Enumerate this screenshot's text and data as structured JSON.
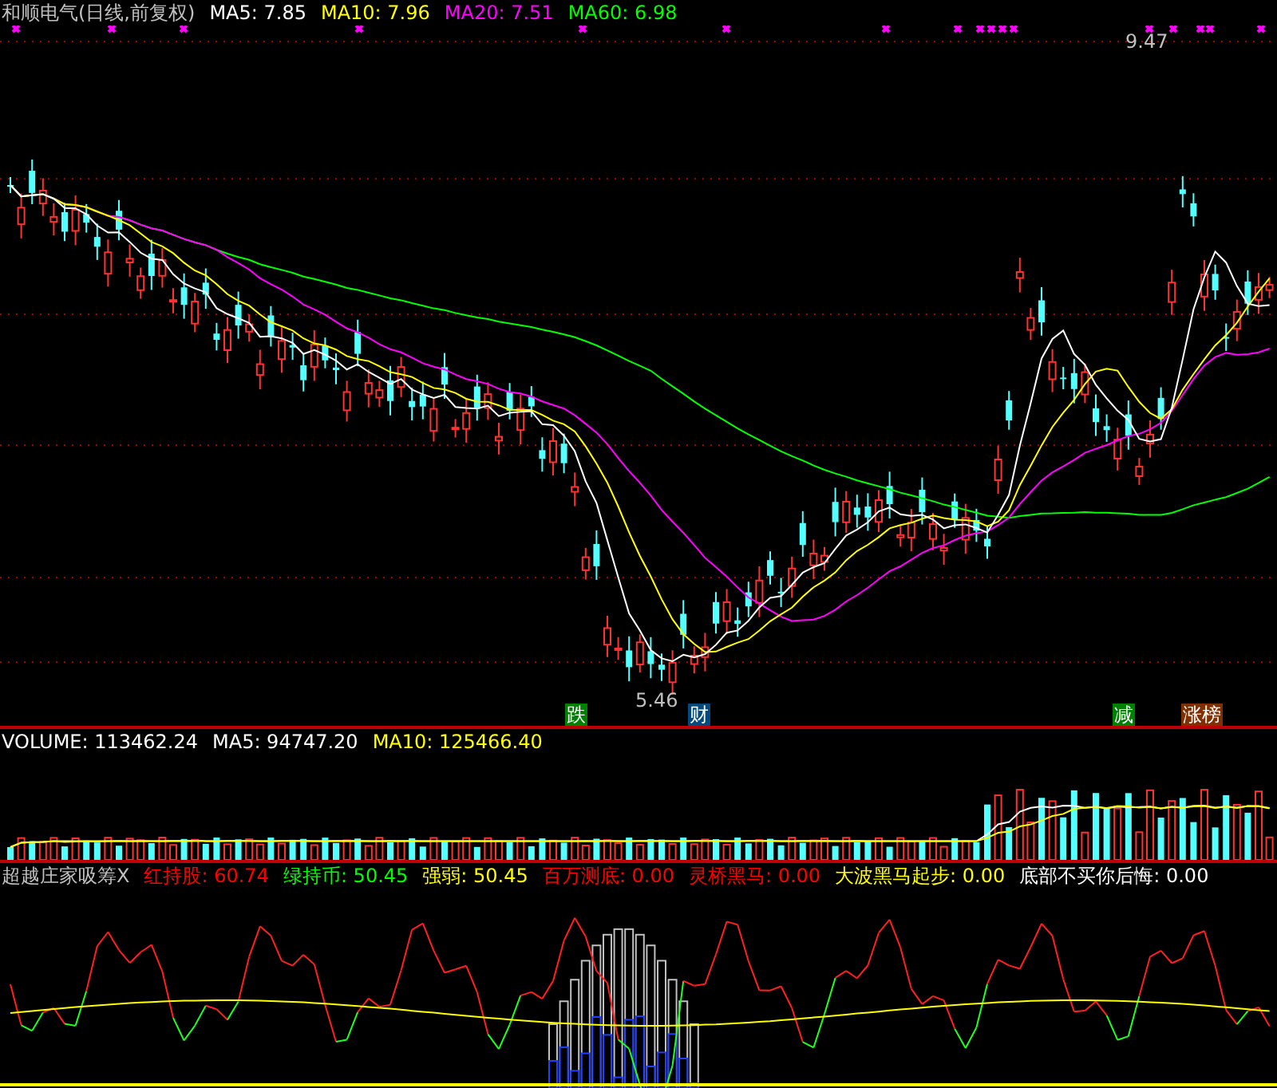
{
  "price_legend": {
    "title": "和顺电气(日线,前复权)",
    "items": [
      {
        "label": "MA5: 7.85",
        "color": "#ffffff"
      },
      {
        "label": "MA10: 7.96",
        "color": "#ffff00"
      },
      {
        "label": "MA20: 7.51",
        "color": "#ff00ff"
      },
      {
        "label": "MA60: 6.98",
        "color": "#00ff00"
      }
    ]
  },
  "price_panel": {
    "high_label": "9.47",
    "low_label": "5.46",
    "signals": [
      {
        "text": "跌",
        "color": "#008000"
      },
      {
        "text": "财",
        "color": "#004a80"
      },
      {
        "text": "减",
        "color": "#008000"
      },
      {
        "text": "涨榜",
        "color": "#803000"
      }
    ]
  },
  "volume_legend": {
    "items": [
      {
        "label": "VOLUME: 113462.24",
        "color": "#ffffff"
      },
      {
        "label": "MA5: 94747.20",
        "color": "#ffffff"
      },
      {
        "label": "MA10: 125466.40",
        "color": "#ffff00"
      }
    ]
  },
  "indicator_legend": {
    "title": "超越庄家吸筹X",
    "items": [
      {
        "label": "红持股: 60.74",
        "color": "#ff0000"
      },
      {
        "label": "绿持币: 50.45",
        "color": "#00ff00"
      },
      {
        "label": "强弱: 50.45",
        "color": "#ffff00"
      },
      {
        "label": "百万测底: 0.00",
        "color": "#ff0000"
      },
      {
        "label": "灵桥黑马: 0.00",
        "color": "#ff0000"
      },
      {
        "label": "大波黑马起步: 0.00",
        "color": "#ffff00"
      },
      {
        "label": "底部不买你后悔: 0.00",
        "color": "#ffffff"
      }
    ]
  }
}
